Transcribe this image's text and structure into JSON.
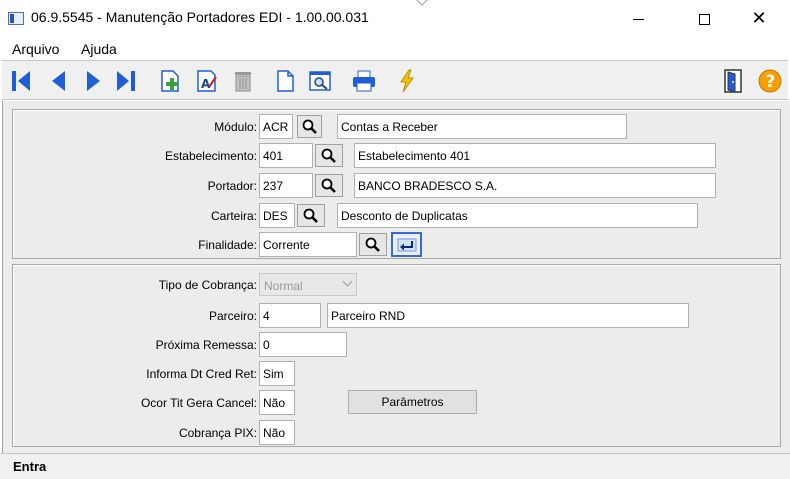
{
  "window": {
    "title": "06.9.5545 - Manutenção Portadores EDI - 1.00.00.031"
  },
  "menu": {
    "items": [
      "Arquivo",
      "Ajuda"
    ]
  },
  "toolbar": {
    "icons": [
      "first-record-icon",
      "previous-record-icon",
      "next-record-icon",
      "last-record-icon",
      "add-record-icon",
      "edit-record-icon",
      "delete-icon",
      "new-document-icon",
      "preview-icon",
      "print-icon",
      "lightning-icon",
      "exit-door-icon",
      "help-icon"
    ],
    "help_label": "?"
  },
  "form": {
    "modulo": {
      "label": "Módulo:",
      "code": "ACR",
      "description": "Contas a Receber"
    },
    "estabelecimento": {
      "label": "Estabelecimento:",
      "code": "401",
      "description": "Estabelecimento 401"
    },
    "portador": {
      "label": "Portador:",
      "code": "237",
      "description": "BANCO BRADESCO S.A."
    },
    "carteira": {
      "label": "Carteira:",
      "code": "DES",
      "description": "Desconto de Duplicatas"
    },
    "finalidade": {
      "label": "Finalidade:",
      "value": "Corrente"
    }
  },
  "details": {
    "tipo_cobranca": {
      "label": "Tipo de Cobrança:",
      "value": "Normal"
    },
    "parceiro": {
      "label": "Parceiro:",
      "code": "4",
      "description": "Parceiro RND"
    },
    "proxima_remessa": {
      "label": "Próxima Remessa:",
      "value": "0"
    },
    "informa_dt_cred_ret": {
      "label": "Informa Dt Cred Ret:",
      "value": "Sim"
    },
    "ocor_tit_gera_cancel": {
      "label": "Ocor Tit Gera Cancel:",
      "value": "Não"
    },
    "cobranca_pix": {
      "label": "Cobrança PIX:",
      "value": "Não"
    },
    "parametros_button": "Parâmetros"
  },
  "status": {
    "text": "Entra"
  },
  "colors": {
    "nav_blue": "#1f5fd6",
    "help_orange": "#f5a000",
    "background": "#ececec"
  }
}
